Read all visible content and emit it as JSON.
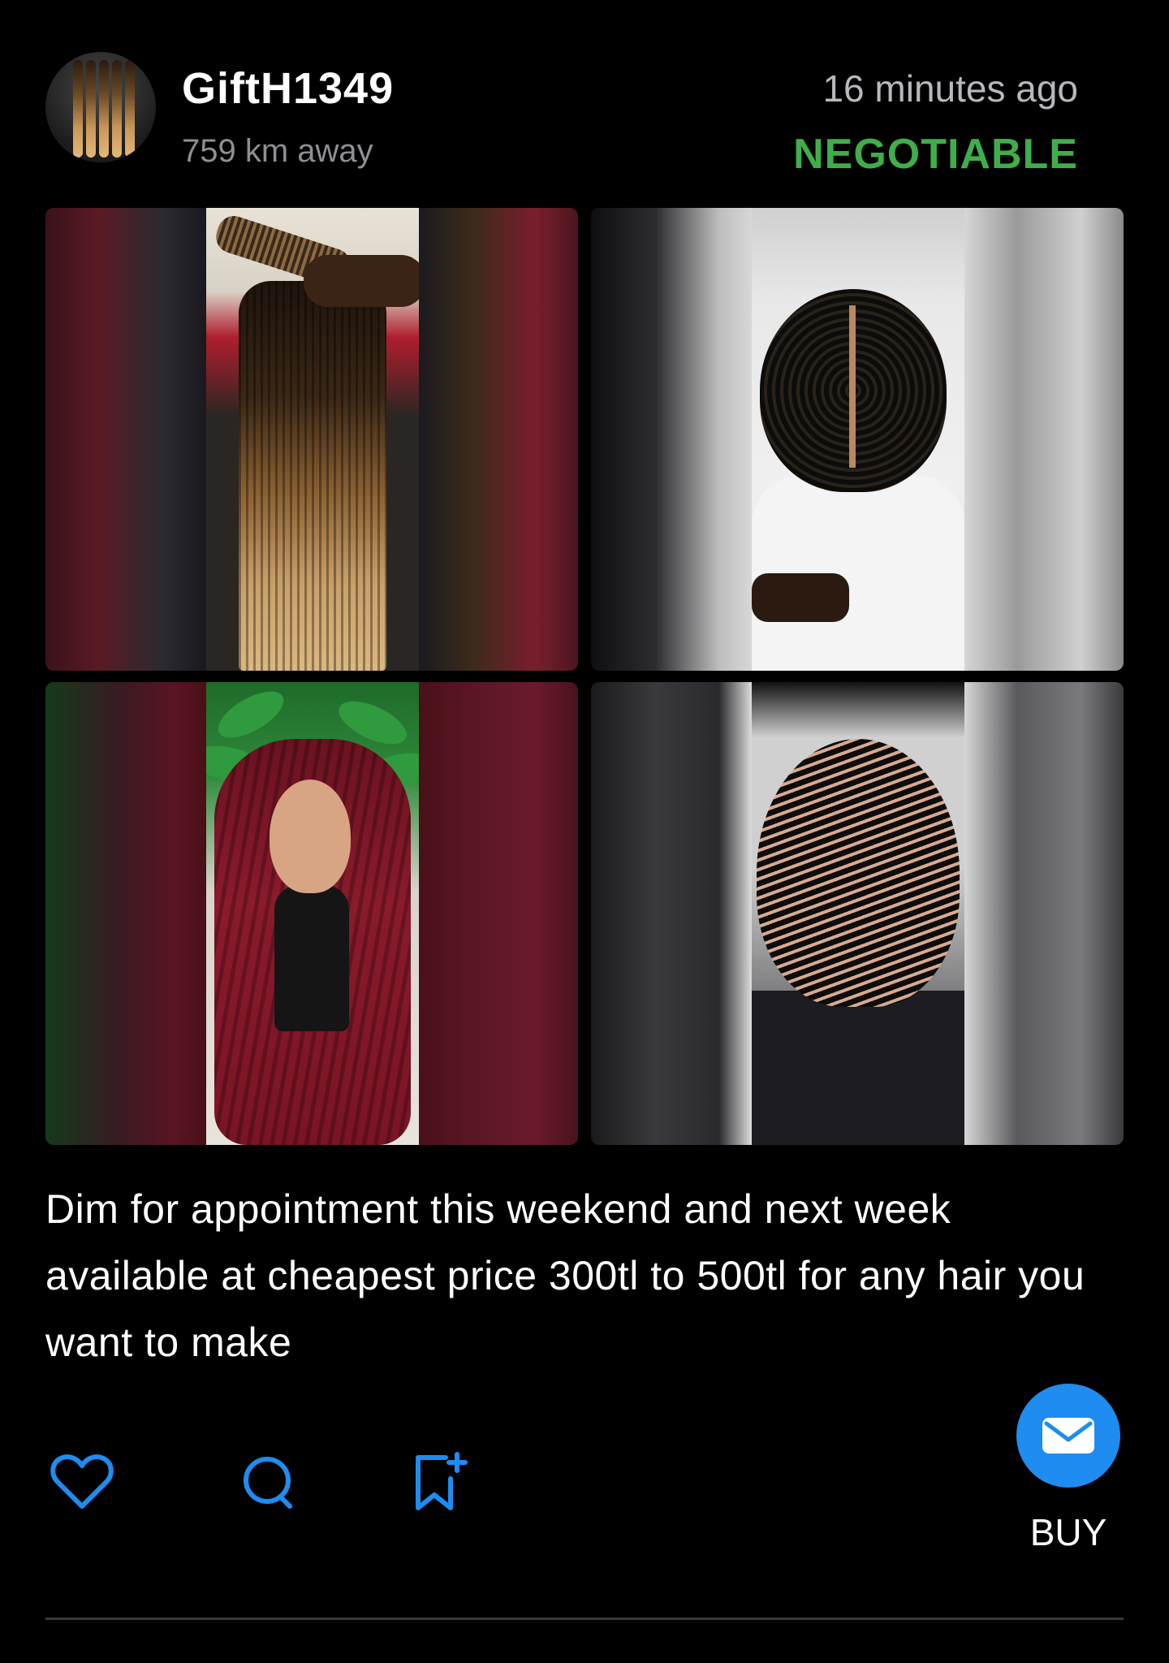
{
  "post": {
    "username": "GiftH1349",
    "distance": "759 km away",
    "time_ago": "16 minutes ago",
    "price_status": "NEGOTIABLE",
    "caption": "Dim for appointment this weekend and next week available at cheapest price 300tl to 500tl for any hair you want to make",
    "images": [
      {
        "subject": "ombre-box-braids-photo"
      },
      {
        "subject": "twists-hairstyle-photo"
      },
      {
        "subject": "burgundy-braided-wig-photo"
      },
      {
        "subject": "stitch-braids-photo"
      }
    ]
  },
  "actions": {
    "like_icon": "heart-icon",
    "comment_icon": "comment-icon",
    "save_icon": "bookmark-add-icon",
    "buy_icon": "envelope-icon",
    "buy_label": "BUY"
  },
  "colors": {
    "background": "#000000",
    "accent_blue": "#1e8cf0",
    "negotiable_green": "#3fae4a",
    "secondary_text": "#8e8e93"
  }
}
